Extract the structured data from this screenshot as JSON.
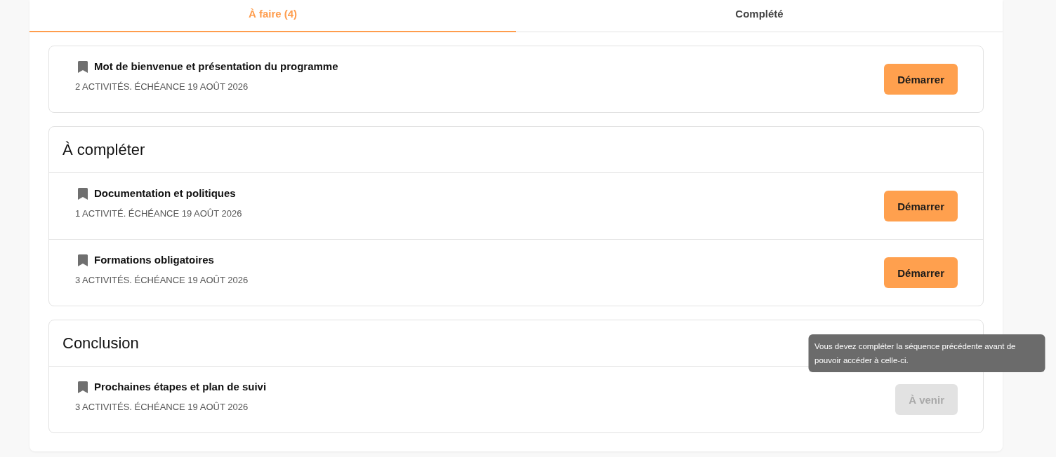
{
  "tabs": [
    {
      "label": "À faire (4)",
      "selected": true
    },
    {
      "label": "Complété",
      "selected": false
    }
  ],
  "sections": [
    {
      "items": [
        {
          "title": "Mot de bienvenue et présentation du programme",
          "meta": "2 ACTIVITÉS. ÉCHÉANCE 19 AOÛT 2026",
          "button": {
            "label": "Démarrer",
            "disabled": false
          }
        }
      ]
    },
    {
      "title": "À compléter",
      "items": [
        {
          "title": "Documentation et politiques",
          "meta": "1 ACTIVITÉ. ÉCHÉANCE 19 AOÛT 2026",
          "button": {
            "label": "Démarrer",
            "disabled": false
          }
        },
        {
          "title": "Formations obligatoires",
          "meta": "3 ACTIVITÉS. ÉCHÉANCE 19 AOÛT 2026",
          "button": {
            "label": "Démarrer",
            "disabled": false
          }
        }
      ]
    },
    {
      "title": "Conclusion",
      "items": [
        {
          "title": "Prochaines étapes et plan de suivi",
          "meta": "3 ACTIVITÉS. ÉCHÉANCE 19 AOÛT 2026",
          "button": {
            "label": "À venir",
            "disabled": true,
            "tooltip": "Vous devez compléter la séquence précédente avant de pouvoir accéder à celle-ci."
          }
        }
      ]
    }
  ]
}
